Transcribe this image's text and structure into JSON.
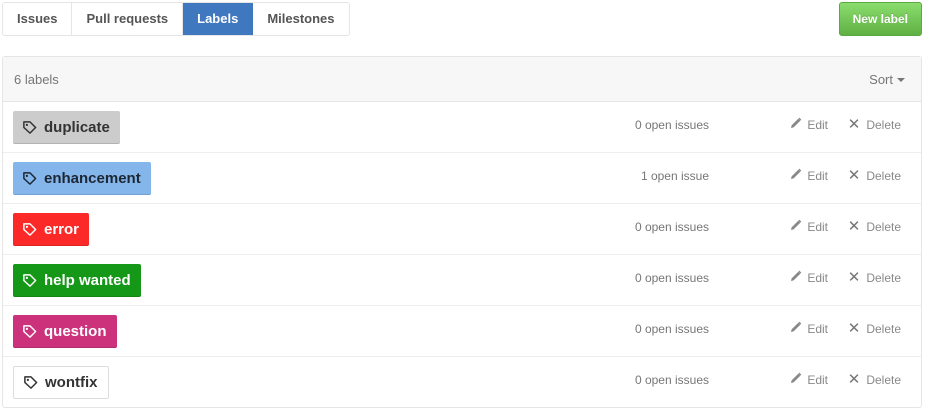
{
  "subnav": {
    "items": [
      {
        "label": "Issues",
        "selected": false
      },
      {
        "label": "Pull requests",
        "selected": false
      },
      {
        "label": "Labels",
        "selected": true
      },
      {
        "label": "Milestones",
        "selected": false
      }
    ]
  },
  "new_label_button": "New label",
  "table": {
    "count": "6 labels",
    "sort_label": "Sort",
    "edit_label": "Edit",
    "delete_label": "Delete",
    "rows": [
      {
        "name": "duplicate",
        "color": "#cccccc",
        "text_color": "#333333",
        "issues": "0 open issues",
        "icon": "tag-icon"
      },
      {
        "name": "enhancement",
        "color": "#84b6eb",
        "text_color": "#1c2733",
        "issues": "1 open issue",
        "icon": "tag-icon"
      },
      {
        "name": "error",
        "color": "#fc2929",
        "text_color": "#ffffff",
        "issues": "0 open issues",
        "icon": "tag-icon"
      },
      {
        "name": "help wanted",
        "color": "#159818",
        "text_color": "#ffffff",
        "issues": "0 open issues",
        "icon": "tag-icon"
      },
      {
        "name": "question",
        "color": "#cc317c",
        "text_color": "#ffffff",
        "issues": "0 open issues",
        "icon": "tag-icon"
      },
      {
        "name": "wontfix",
        "color": "#ffffff",
        "text_color": "#333333",
        "issues": "0 open issues",
        "icon": "tag-icon"
      }
    ]
  }
}
